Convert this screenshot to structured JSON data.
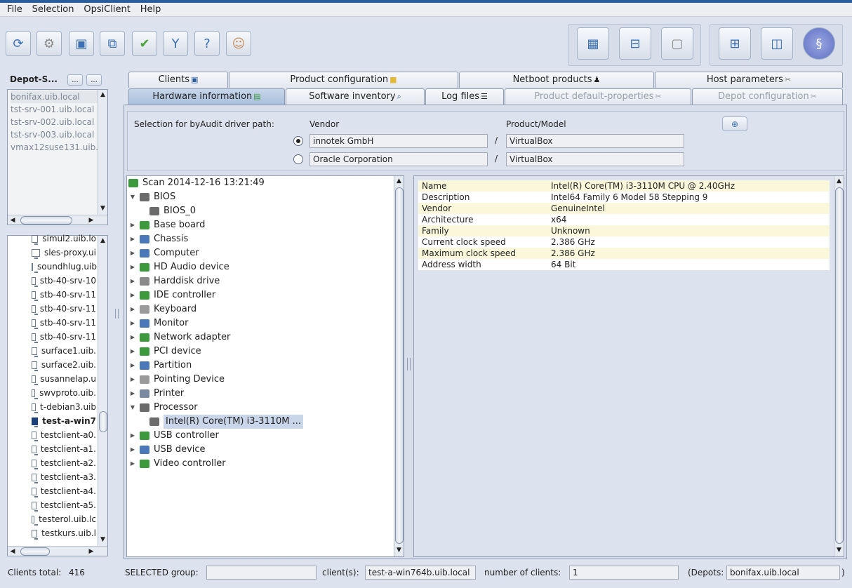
{
  "menu": [
    "File",
    "Selection",
    "OpsiClient",
    "Help"
  ],
  "toolbar": {
    "left_icons": [
      "reload-icon",
      "connect-icon",
      "session-icon",
      "clients-copy-icon",
      "check-icon",
      "filter-icon",
      "help-wifi-icon",
      "users-icon"
    ],
    "right_icons_group1": [
      "client-grid-icon",
      "client-groups-icon",
      "server-icon"
    ],
    "right_icons_group2": [
      "windows-icon",
      "product-icon",
      "license-icon"
    ]
  },
  "depot": {
    "label": "Depot-S...",
    "btn1": "...",
    "btn2": "...",
    "items": [
      "bonifax.uib.local",
      "tst-srv-001.uib.local",
      "tst-srv-002.uib.local",
      "tst-srv-003.uib.local",
      "vmax12suse131.uib.l"
    ]
  },
  "clients": {
    "items": [
      "simul2.uib.lo",
      "sles-proxy.ui",
      "soundhlug.uib",
      "stb-40-srv-10",
      "stb-40-srv-11",
      "stb-40-srv-11",
      "stb-40-srv-11",
      "stb-40-srv-11",
      "surface1.uib.",
      "surface2.uib.",
      "susannelap.u",
      "swvproto.uib.",
      "t-debian3.uib",
      "test-a-win7",
      "testclient-a0.",
      "testclient-a1.",
      "testclient-a2.",
      "testclient-a3.",
      "testclient-a4.",
      "testclient-a5.",
      "testerol.uib.lc",
      "testkurs.uib.l"
    ],
    "selected_index": 13
  },
  "tabs_top": [
    {
      "label": "Clients",
      "icon": "monitor-icon"
    },
    {
      "label": "Product configuration",
      "icon": "box-icon"
    },
    {
      "label": "Netboot products",
      "icon": "penguin-icon"
    },
    {
      "label": "Host parameters",
      "icon": "tools-icon"
    }
  ],
  "tabs_bottom": [
    {
      "label": "Hardware information",
      "icon": "board-icon",
      "active": true
    },
    {
      "label": "Software inventory",
      "icon": "magnifier-icon"
    },
    {
      "label": "Log files",
      "icon": "document-icon"
    },
    {
      "label": "Product default-properties",
      "icon": "tools-icon",
      "disabled": true
    },
    {
      "label": "Depot configuration",
      "icon": "tools-icon",
      "disabled": true
    }
  ],
  "driver": {
    "label": "Selection for byAudit driver path:",
    "vendor_header": "Vendor",
    "model_header": "Product/Model",
    "sep": "/",
    "row1": {
      "vendor": "innotek GmbH",
      "model": "VirtualBox",
      "selected": true
    },
    "row2": {
      "vendor": "Oracle Corporation",
      "model": "VirtualBox",
      "selected": false
    }
  },
  "tree": {
    "scan": "Scan 2014-12-16 13:21:49",
    "nodes": [
      {
        "label": "BIOS",
        "expanded": true,
        "level": 1,
        "color": "#6b6b6b"
      },
      {
        "label": "BIOS_0",
        "level": 2,
        "color": "#6b6b6b"
      },
      {
        "label": "Base board",
        "level": 1,
        "color": "#3c9a3c"
      },
      {
        "label": "Chassis",
        "level": 1,
        "color": "#4a78b8"
      },
      {
        "label": "Computer",
        "level": 1,
        "color": "#4a78b8"
      },
      {
        "label": "HD Audio device",
        "level": 1,
        "color": "#3c9a3c"
      },
      {
        "label": "Harddisk drive",
        "level": 1,
        "color": "#8a8a8a"
      },
      {
        "label": "IDE controller",
        "level": 1,
        "color": "#3c9a3c"
      },
      {
        "label": "Keyboard",
        "level": 1,
        "color": "#9a9a9a"
      },
      {
        "label": "Monitor",
        "level": 1,
        "color": "#4a78b8"
      },
      {
        "label": "Network adapter",
        "level": 1,
        "color": "#3c9a3c"
      },
      {
        "label": "PCI device",
        "level": 1,
        "color": "#3c9a3c"
      },
      {
        "label": "Partition",
        "level": 1,
        "color": "#4a78b8"
      },
      {
        "label": "Pointing Device",
        "level": 1,
        "color": "#9a9a9a"
      },
      {
        "label": "Printer",
        "level": 1,
        "color": "#7a8aa0"
      },
      {
        "label": "Processor",
        "expanded": true,
        "level": 1,
        "color": "#6b6b6b"
      },
      {
        "label": "Intel(R) Core(TM) i3-3110M ...",
        "level": 2,
        "color": "#6b6b6b",
        "selected": true
      },
      {
        "label": "USB controller",
        "level": 1,
        "color": "#3c9a3c"
      },
      {
        "label": "USB device",
        "level": 1,
        "color": "#4a78b8"
      },
      {
        "label": "Video controller",
        "level": 1,
        "color": "#3c9a3c"
      }
    ]
  },
  "properties": [
    {
      "key": "Name",
      "value": "Intel(R) Core(TM) i3-3110M CPU @ 2.40GHz"
    },
    {
      "key": "Description",
      "value": "Intel64 Family 6 Model 58 Stepping 9"
    },
    {
      "key": "Vendor",
      "value": "GenuineIntel"
    },
    {
      "key": "Architecture",
      "value": "x64"
    },
    {
      "key": "Family",
      "value": "Unknown"
    },
    {
      "key": "Current clock speed",
      "value": "2.386 GHz"
    },
    {
      "key": "Maximum clock speed",
      "value": "2.386 GHz"
    },
    {
      "key": "Address width",
      "value": "64 Bit"
    }
  ],
  "status": {
    "clients_total_label": "Clients total:",
    "clients_total": "416",
    "selected_group_label": "SELECTED  group:",
    "selected_group": "",
    "clients_label": "client(s):",
    "clients_value": "test-a-win764b.uib.local",
    "number_label": "number of clients:",
    "number_value": "1",
    "depots_label": "(Depots:",
    "depots_value": "bonifax.uib.local",
    "close_paren": ")"
  }
}
